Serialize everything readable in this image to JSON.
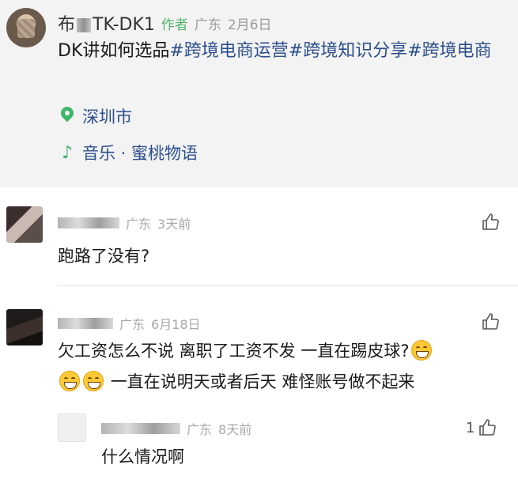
{
  "post": {
    "author_name": "布",
    "author_name_tail": "TK-DK1",
    "author_tag": "作者",
    "region": "广东",
    "date": "2月6日",
    "text": "DK讲如何选品",
    "hashtags": [
      "#跨境电商运营",
      "#跨境知识分享",
      "#跨境电商"
    ],
    "location": "深圳市",
    "music": "音乐 · 蜜桃物语"
  },
  "comments": [
    {
      "region": "广东",
      "time": "3天前",
      "text": "跑路了没有?"
    },
    {
      "region": "广东",
      "time": "6月18日",
      "text_line1": "欠工资怎么不说 离职了工资不发 一直在踢皮球?",
      "text_line2": "一直在说明天或者后天 难怪账号做不起来"
    },
    {
      "region": "广东",
      "time": "8天前",
      "text": "什么情况啊",
      "likes": "1"
    }
  ],
  "icons": {
    "location": "location-pin-icon",
    "music": "music-note-icon",
    "like": "thumb-up-icon",
    "emoji": "grinning-face-emoji"
  },
  "colors": {
    "post_bg": "#f3f3f3",
    "hashtag": "#2c4f8c",
    "author_tag": "#54b36a",
    "accent_icon": "#3fb56c",
    "meta": "#a8a8a8"
  }
}
